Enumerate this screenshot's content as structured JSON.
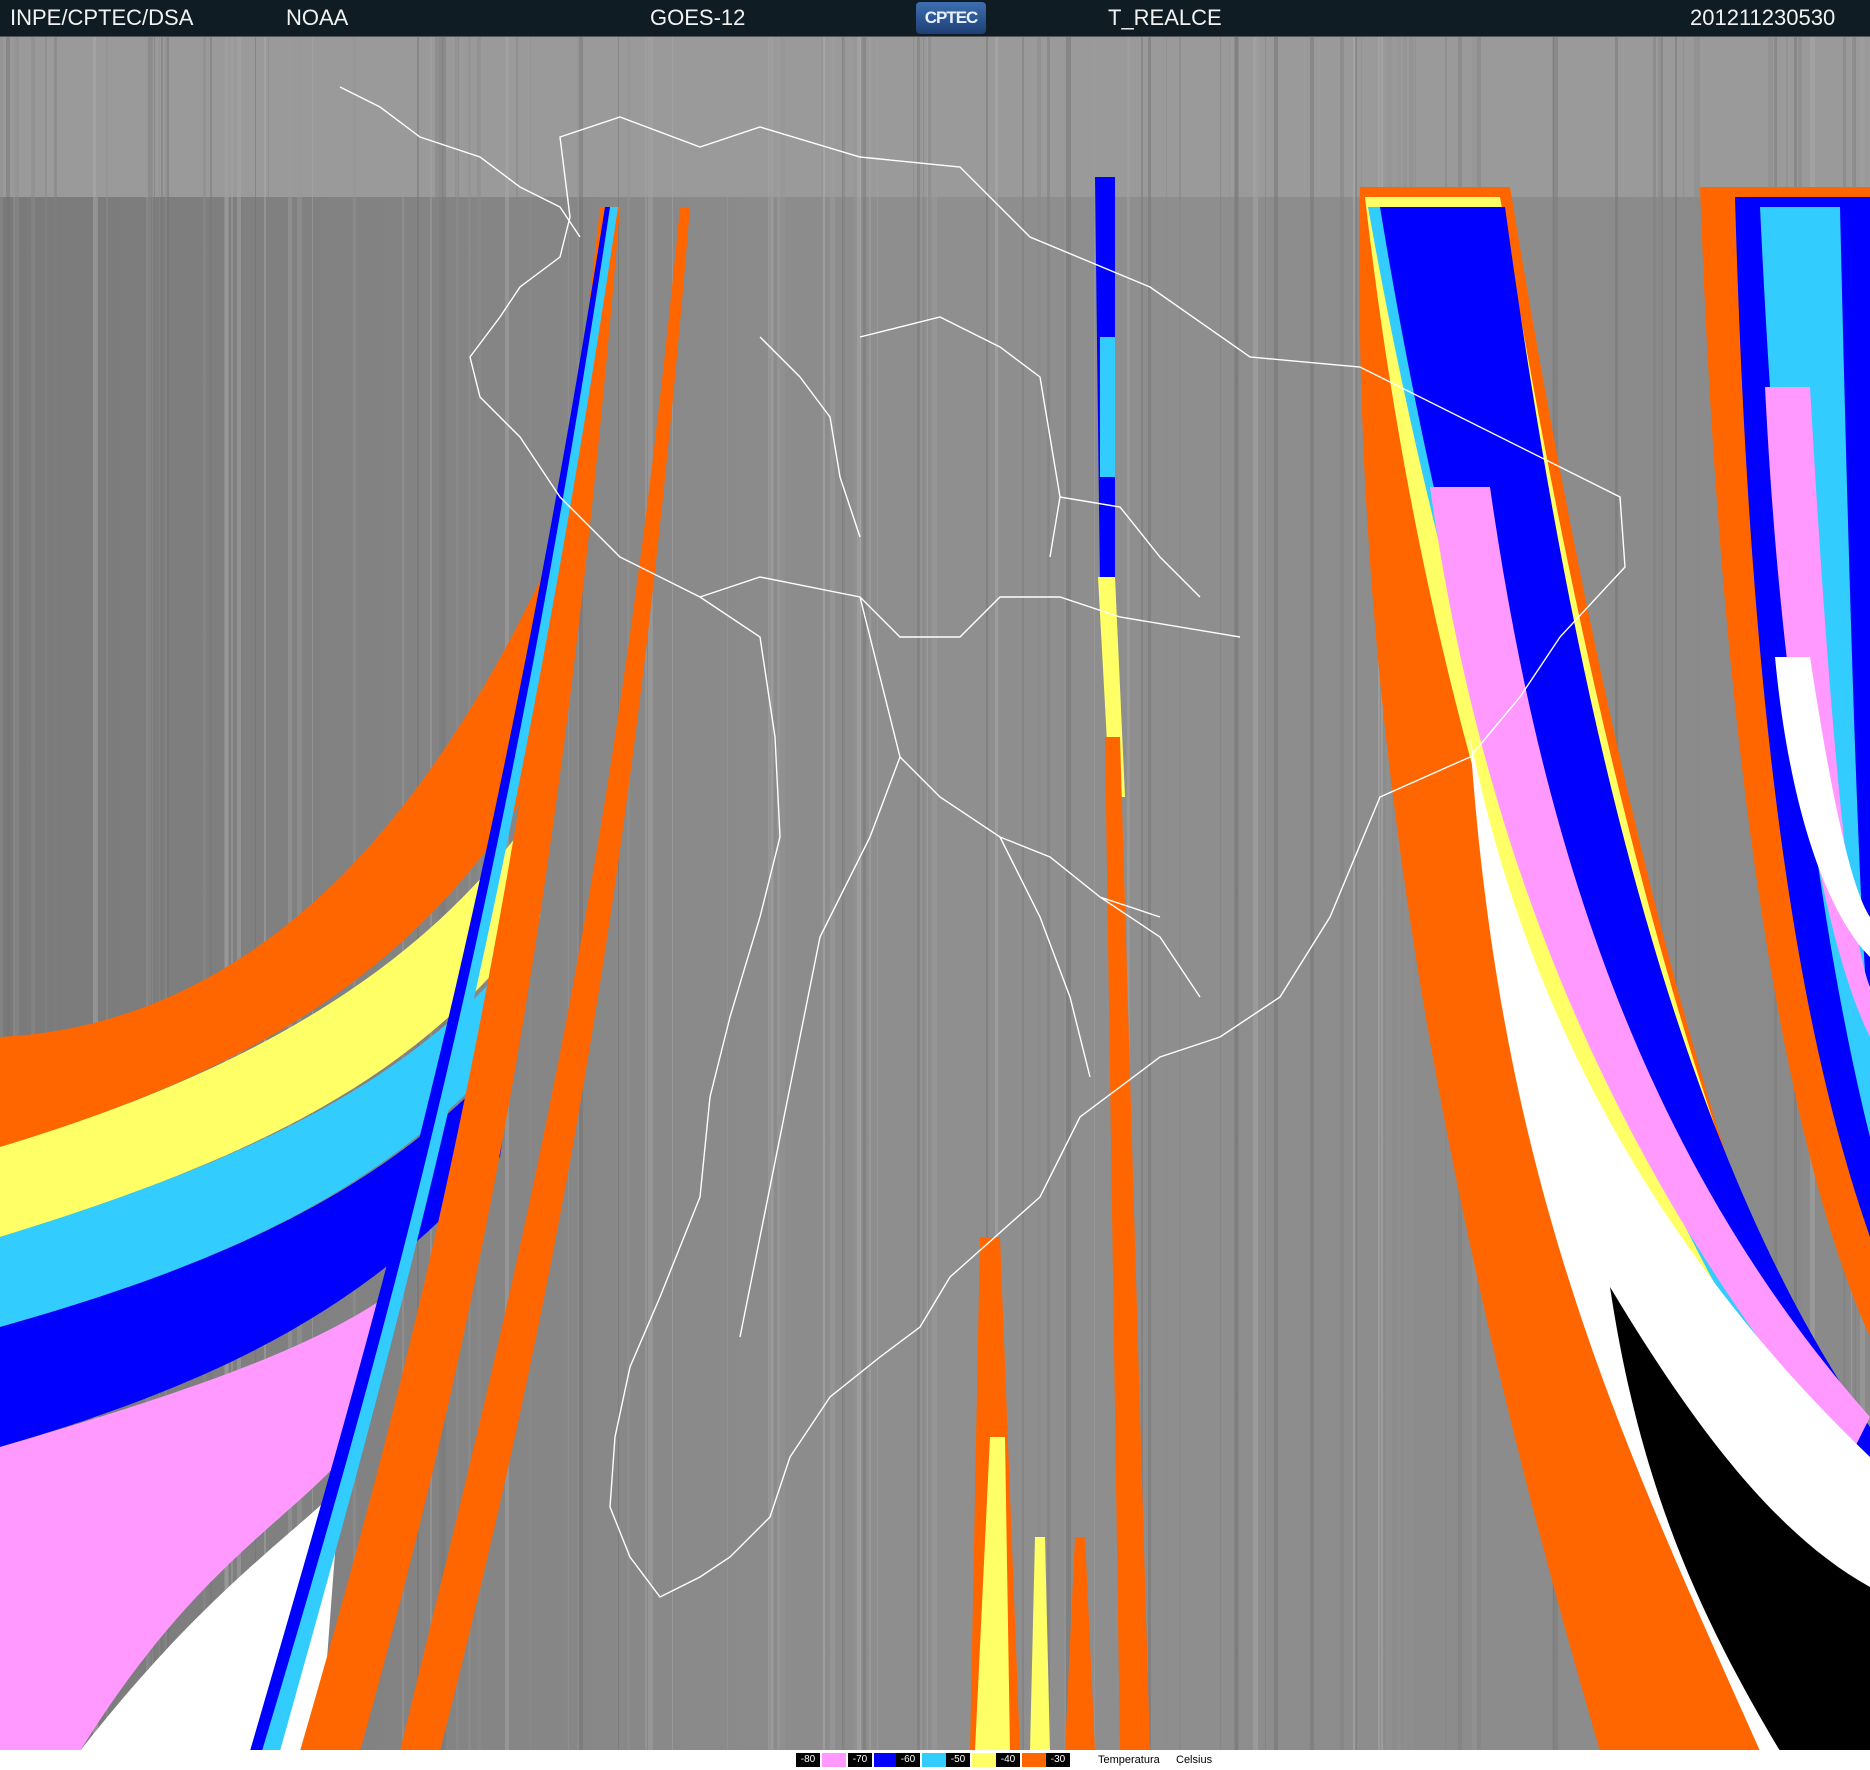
{
  "header": {
    "institute": "INPE/CPTEC/DSA",
    "agency": "NOAA",
    "satellite": "GOES-12",
    "logo_text": "CPTEC",
    "product": "T_REALCE",
    "datetime": "201211230530"
  },
  "legend": {
    "entries": [
      {
        "label": "-80",
        "color": "#ff99ff"
      },
      {
        "label": "-70",
        "color": "#0000ff"
      },
      {
        "label": "-60",
        "color": "#33ccff"
      },
      {
        "label": "-50",
        "color": "#ffff66"
      },
      {
        "label": "-40",
        "color": "#ff6600"
      },
      {
        "label": "-30",
        "color": "#ff6600"
      }
    ],
    "title": "Temperatura",
    "unit": "Celsius"
  },
  "colors": {
    "background_gray": "#8a8a8a",
    "band_orange": "#ff6600",
    "band_yellow": "#ffff66",
    "band_cyan": "#33ccff",
    "band_blue": "#0000ff",
    "band_pink": "#ff99ff",
    "band_white": "#ffffff",
    "band_black": "#000000",
    "header_bg": "#0f1c24",
    "coastline": "#ffffff"
  }
}
